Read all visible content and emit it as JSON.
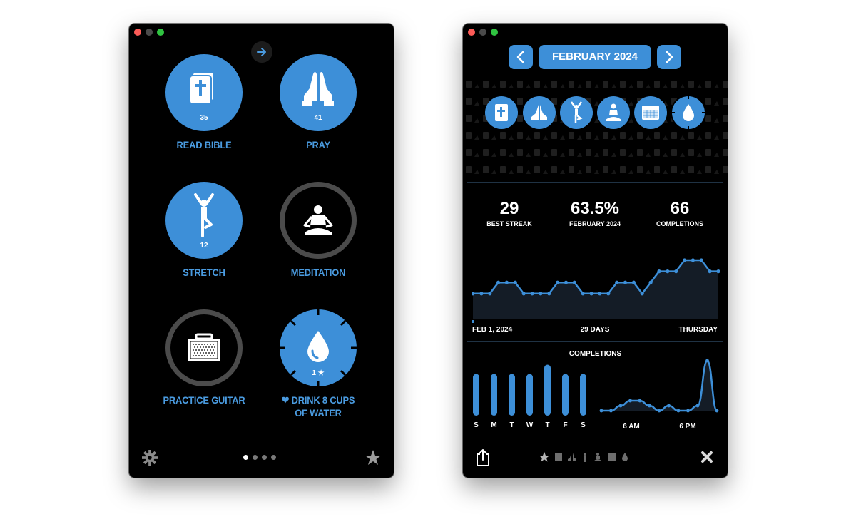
{
  "left_window": {
    "nav_arrow_icon": "arrow-right-icon",
    "habits": [
      {
        "label": "READ BIBLE",
        "count": "35",
        "icon": "bible-icon",
        "state": "complete"
      },
      {
        "label": "PRAY",
        "count": "41",
        "icon": "praying-hands-icon",
        "state": "complete"
      },
      {
        "label": "STRETCH",
        "count": "12",
        "icon": "yoga-pose-icon",
        "state": "complete"
      },
      {
        "label": "MEDITATION",
        "count": "",
        "icon": "meditation-icon",
        "state": "incomplete"
      },
      {
        "label": "PRACTICE GUITAR",
        "count": "",
        "icon": "amplifier-icon",
        "state": "incomplete"
      },
      {
        "label_line1": "❤ DRINK 8 CUPS",
        "label_line2": "OF WATER",
        "count": "1 ★",
        "icon": "water-drop-icon",
        "state": "complete-with-ticks"
      }
    ],
    "footer": {
      "settings_icon": "gear-icon",
      "favorites_icon": "star-icon",
      "page_dots": 4,
      "active_page": 1
    }
  },
  "right_window": {
    "month_title": "FEBRUARY 2024",
    "habit_filter_icons": [
      "bible-icon",
      "praying-hands-icon",
      "yoga-pose-icon",
      "meditation-icon",
      "calendar-icon",
      "water-drop-icon"
    ],
    "selected_filter": "water-drop-icon",
    "stats": [
      {
        "value": "29",
        "label": "BEST STREAK"
      },
      {
        "value": "63.5%",
        "label": "FEBRUARY 2024"
      },
      {
        "value": "66",
        "label": "COMPLETIONS"
      }
    ],
    "streak_axis": {
      "start": "FEB 1, 2024",
      "middle": "29 DAYS",
      "end": "THURSDAY"
    },
    "completions_title": "COMPLETIONS",
    "weekday_labels": [
      "S",
      "M",
      "T",
      "W",
      "T",
      "F",
      "S"
    ],
    "time_labels": [
      "6 AM",
      "6 PM"
    ],
    "footer": {
      "share_icon": "share-icon",
      "close_icon": "close-x-icon",
      "filter_icons": [
        "star-icon",
        "bible-icon",
        "praying-hands-icon",
        "yoga-pose-icon",
        "meditation-icon",
        "calendar-icon",
        "water-drop-icon"
      ]
    },
    "accent_color": "#3d8fd8"
  },
  "chart_data": [
    {
      "type": "area",
      "title": "",
      "x": [
        1,
        2,
        3,
        4,
        5,
        6,
        7,
        8,
        9,
        10,
        11,
        12,
        13,
        14,
        15,
        16,
        17,
        18,
        19,
        20,
        21,
        22,
        23,
        24,
        25,
        26,
        27,
        28,
        29,
        30
      ],
      "values": [
        2,
        2,
        2,
        3,
        3,
        3,
        2,
        2,
        2,
        2,
        3,
        3,
        3,
        2,
        2,
        2,
        2,
        3,
        3,
        3,
        2,
        3,
        4,
        4,
        4,
        5,
        5,
        5,
        4,
        4
      ],
      "xlabel": "29 DAYS",
      "ylabel": ""
    },
    {
      "type": "bar",
      "title": "COMPLETIONS",
      "categories": [
        "S",
        "M",
        "T",
        "W",
        "T",
        "F",
        "S"
      ],
      "values": [
        9,
        9,
        9,
        9,
        11,
        9,
        9
      ]
    },
    {
      "type": "area",
      "title": "COMPLETIONS",
      "x": [
        "",
        "",
        "",
        "",
        "",
        "",
        "",
        "",
        "",
        "",
        "",
        "",
        ""
      ],
      "values": [
        0,
        0,
        1,
        2,
        2,
        1,
        0,
        1,
        0,
        0,
        1,
        10,
        0
      ],
      "tick_labels": [
        "6 AM",
        "6 PM"
      ]
    }
  ]
}
